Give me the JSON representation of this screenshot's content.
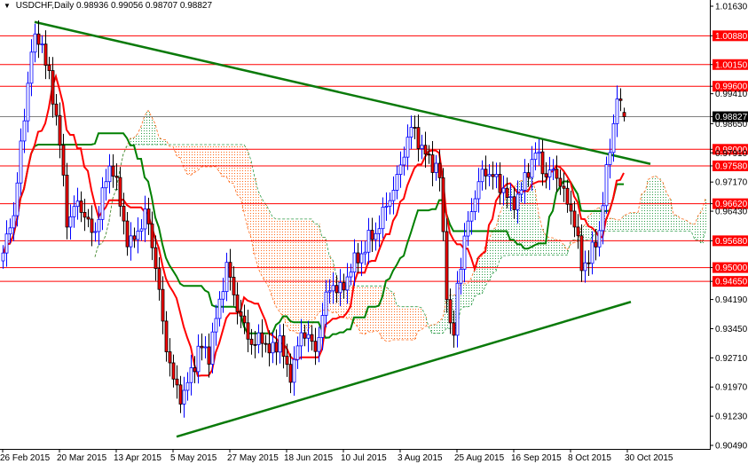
{
  "header": {
    "symbol": "USDCHF,Daily",
    "open": "0.98936",
    "high": "0.99056",
    "low": "0.98707",
    "close": "0.98827"
  },
  "colors": {
    "bull": "#0000ff",
    "bear_body": "#ff0000",
    "bear_outline": "#000000",
    "tenkan": "#ff0000",
    "kijun": "#008000",
    "cloud_up": "#2e9d4a",
    "cloud_down": "#ff6a1a",
    "level": "#ff0000",
    "trendline": "#0a7a0a",
    "current": "#808080"
  },
  "chart_data": {
    "type": "candlestick",
    "title": "USDCHF,Daily",
    "ylim": [
      0.9049,
      1.0163
    ],
    "y_ticks": [
      "1.01630",
      "1.00880",
      "1.00150",
      "0.99600",
      "0.99410",
      "0.98827",
      "0.98650",
      "0.98000",
      "0.97910",
      "0.97580",
      "0.97170",
      "0.96620",
      "0.96430",
      "0.95680",
      "0.95000",
      "0.94650",
      "0.94190",
      "0.93450",
      "0.92710",
      "0.91970",
      "0.91230",
      "0.90490"
    ],
    "y_tick_values": [
      1.0163,
      1.0088,
      1.0015,
      0.996,
      0.9941,
      0.98827,
      0.9865,
      0.98,
      0.9791,
      0.9758,
      0.9717,
      0.9662,
      0.9643,
      0.9568,
      0.95,
      0.9465,
      0.9419,
      0.9345,
      0.9271,
      0.9197,
      0.9123,
      0.9049
    ],
    "x_ticks": [
      {
        "label": "26 Feb 2015",
        "bar": 0
      },
      {
        "label": "20 Mar 2015",
        "bar": 16
      },
      {
        "label": "13 Apr 2015",
        "bar": 32
      },
      {
        "label": "5 May 2015",
        "bar": 48
      },
      {
        "label": "27 May 2015",
        "bar": 64
      },
      {
        "label": "18 Jun 2015",
        "bar": 80
      },
      {
        "label": "10 Jul 2015",
        "bar": 96
      },
      {
        "label": "3 Aug 2015",
        "bar": 112
      },
      {
        "label": "25 Aug 2015",
        "bar": 128
      },
      {
        "label": "16 Sep 2015",
        "bar": 144
      },
      {
        "label": "8 Oct 2015",
        "bar": 160
      },
      {
        "label": "30 Oct 2015",
        "bar": 176
      }
    ],
    "levels": [
      {
        "label": "1.00880",
        "value": 1.0088
      },
      {
        "label": "1.00150",
        "value": 1.0015
      },
      {
        "label": "0.99600",
        "value": 0.996
      },
      {
        "label": "0.98000",
        "value": 0.98
      },
      {
        "label": "0.97580",
        "value": 0.9758
      },
      {
        "label": "0.96620",
        "value": 0.9662
      },
      {
        "label": "0.95680",
        "value": 0.9568
      },
      {
        "label": "0.95000",
        "value": 0.95
      },
      {
        "label": "0.94650",
        "value": 0.9465
      }
    ],
    "current_price": {
      "label": "0.98827",
      "value": 0.98827
    },
    "trendlines": [
      {
        "name": "upper",
        "from": [
          9,
          1.0123
        ],
        "to": [
          182.5,
          0.9763
        ]
      },
      {
        "name": "lower",
        "from": [
          49,
          0.9071
        ],
        "to": [
          177,
          0.9413
        ]
      }
    ],
    "bar_count": 176,
    "close_path": [
      [
        0,
        0.9537
      ],
      [
        3,
        0.9639
      ],
      [
        5.5,
        0.9841
      ],
      [
        8,
        1.0055
      ],
      [
        10.5,
        1.0089
      ],
      [
        13,
        0.9976
      ],
      [
        15.5,
        0.9864
      ],
      [
        18,
        0.9616
      ],
      [
        20.5,
        0.9661
      ],
      [
        23,
        0.9639
      ],
      [
        25.5,
        0.9571
      ],
      [
        28,
        0.9684
      ],
      [
        30.5,
        0.9774
      ],
      [
        33,
        0.9661
      ],
      [
        35.5,
        0.9549
      ],
      [
        38,
        0.9594
      ],
      [
        40.5,
        0.9639
      ],
      [
        43,
        0.9504
      ],
      [
        45.5,
        0.9324
      ],
      [
        48,
        0.9211
      ],
      [
        50.5,
        0.9166
      ],
      [
        53,
        0.9234
      ],
      [
        55.5,
        0.9301
      ],
      [
        58,
        0.9279
      ],
      [
        60.5,
        0.9391
      ],
      [
        63,
        0.9504
      ],
      [
        65.5,
        0.9414
      ],
      [
        68,
        0.9346
      ],
      [
        70.5,
        0.9301
      ],
      [
        73,
        0.9324
      ],
      [
        75.5,
        0.9279
      ],
      [
        78,
        0.9324
      ],
      [
        80.5,
        0.9211
      ],
      [
        83,
        0.9301
      ],
      [
        85.5,
        0.9346
      ],
      [
        88,
        0.9279
      ],
      [
        90.5,
        0.9414
      ],
      [
        93,
        0.9459
      ],
      [
        95.5,
        0.9436
      ],
      [
        98,
        0.9504
      ],
      [
        100.5,
        0.9526
      ],
      [
        103,
        0.9571
      ],
      [
        105.5,
        0.9594
      ],
      [
        108,
        0.9661
      ],
      [
        110.5,
        0.9706
      ],
      [
        113,
        0.9796
      ],
      [
        115.5,
        0.9864
      ],
      [
        118,
        0.9796
      ],
      [
        120.5,
        0.9774
      ],
      [
        123,
        0.9729
      ],
      [
        125.5,
        0.9369
      ],
      [
        126.8,
        0.9301
      ],
      [
        128,
        0.9459
      ],
      [
        130.5,
        0.9594
      ],
      [
        133,
        0.9684
      ],
      [
        135.5,
        0.9751
      ],
      [
        138,
        0.9729
      ],
      [
        140.5,
        0.9706
      ],
      [
        143,
        0.9661
      ],
      [
        145.5,
        0.9684
      ],
      [
        148,
        0.9751
      ],
      [
        150.5,
        0.9796
      ],
      [
        153,
        0.9729
      ],
      [
        155.5,
        0.9751
      ],
      [
        158,
        0.9684
      ],
      [
        160.5,
        0.9639
      ],
      [
        163,
        0.9504
      ],
      [
        165.5,
        0.9526
      ],
      [
        168,
        0.9594
      ],
      [
        170.5,
        0.9774
      ],
      [
        173,
        0.9931
      ],
      [
        174.5,
        0.9894
      ],
      [
        175.5,
        0.98827
      ]
    ]
  }
}
